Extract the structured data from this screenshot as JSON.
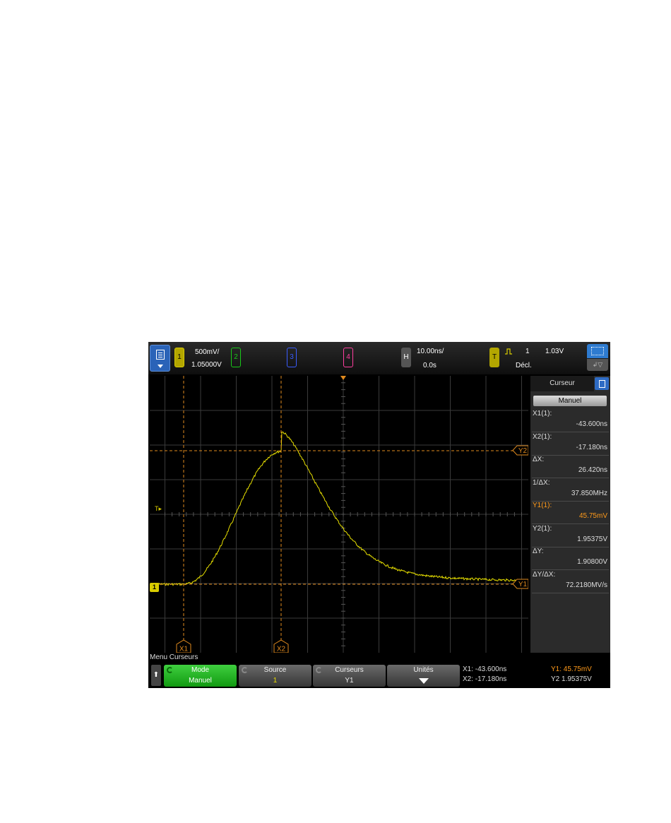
{
  "topbar": {
    "ch1": {
      "num": "1",
      "scale": "500mV/",
      "offset": "1.05000V",
      "color": "#d8cc00"
    },
    "ch2": {
      "num": "2",
      "color": "#19c819"
    },
    "ch3": {
      "num": "3",
      "color": "#3a5cff"
    },
    "ch4": {
      "num": "4",
      "color": "#ff3fa0"
    },
    "horizontal": {
      "label": "H",
      "scale": "10.00ns/",
      "delay": "0.0s"
    },
    "trigger": {
      "label": "T",
      "source": "1",
      "level": "1.03V",
      "mode": "Décl."
    }
  },
  "side_panel": {
    "tab_label": "Curseur",
    "mode_button": "Manuel",
    "measurements": [
      {
        "label": "X1(1):",
        "value": "-43.600ns"
      },
      {
        "label": "X2(1):",
        "value": "-17.180ns"
      },
      {
        "label": "ΔX:",
        "value": "26.420ns"
      },
      {
        "label": "1/ΔX:",
        "value": "37.850MHz"
      },
      {
        "label": "Y1(1):",
        "value": "45.75mV"
      },
      {
        "label": "Y2(1):",
        "value": "1.95375V"
      },
      {
        "label": "ΔY:",
        "value": "1.90800V"
      },
      {
        "label": "ΔY/ΔX:",
        "value": "72.2180MV/s"
      }
    ]
  },
  "cursor_labels": {
    "x1": "X1",
    "x2": "X2",
    "y1": "Y1",
    "y2": "Y2"
  },
  "ground_marker": "1",
  "trigger_marker": "T",
  "softkeys": {
    "menu_title": "Menu Curseurs",
    "up": "⬆",
    "mode": {
      "title": "Mode",
      "value": "Manuel"
    },
    "source": {
      "title": "Source",
      "value": "1"
    },
    "cursors": {
      "title": "Curseurs",
      "value": "Y1"
    },
    "units": {
      "title": "Unités"
    }
  },
  "readout": {
    "x1": "X1: -43.600ns",
    "x2": "X2: -17.180ns",
    "y1": "Y1: 45.75mV",
    "y2": "Y2  1.95375V"
  },
  "colors": {
    "trace": "#e8e000",
    "cursor": "#e08a1e",
    "grid": "#3a3a3a",
    "highlight": "#ff9a1a"
  }
}
